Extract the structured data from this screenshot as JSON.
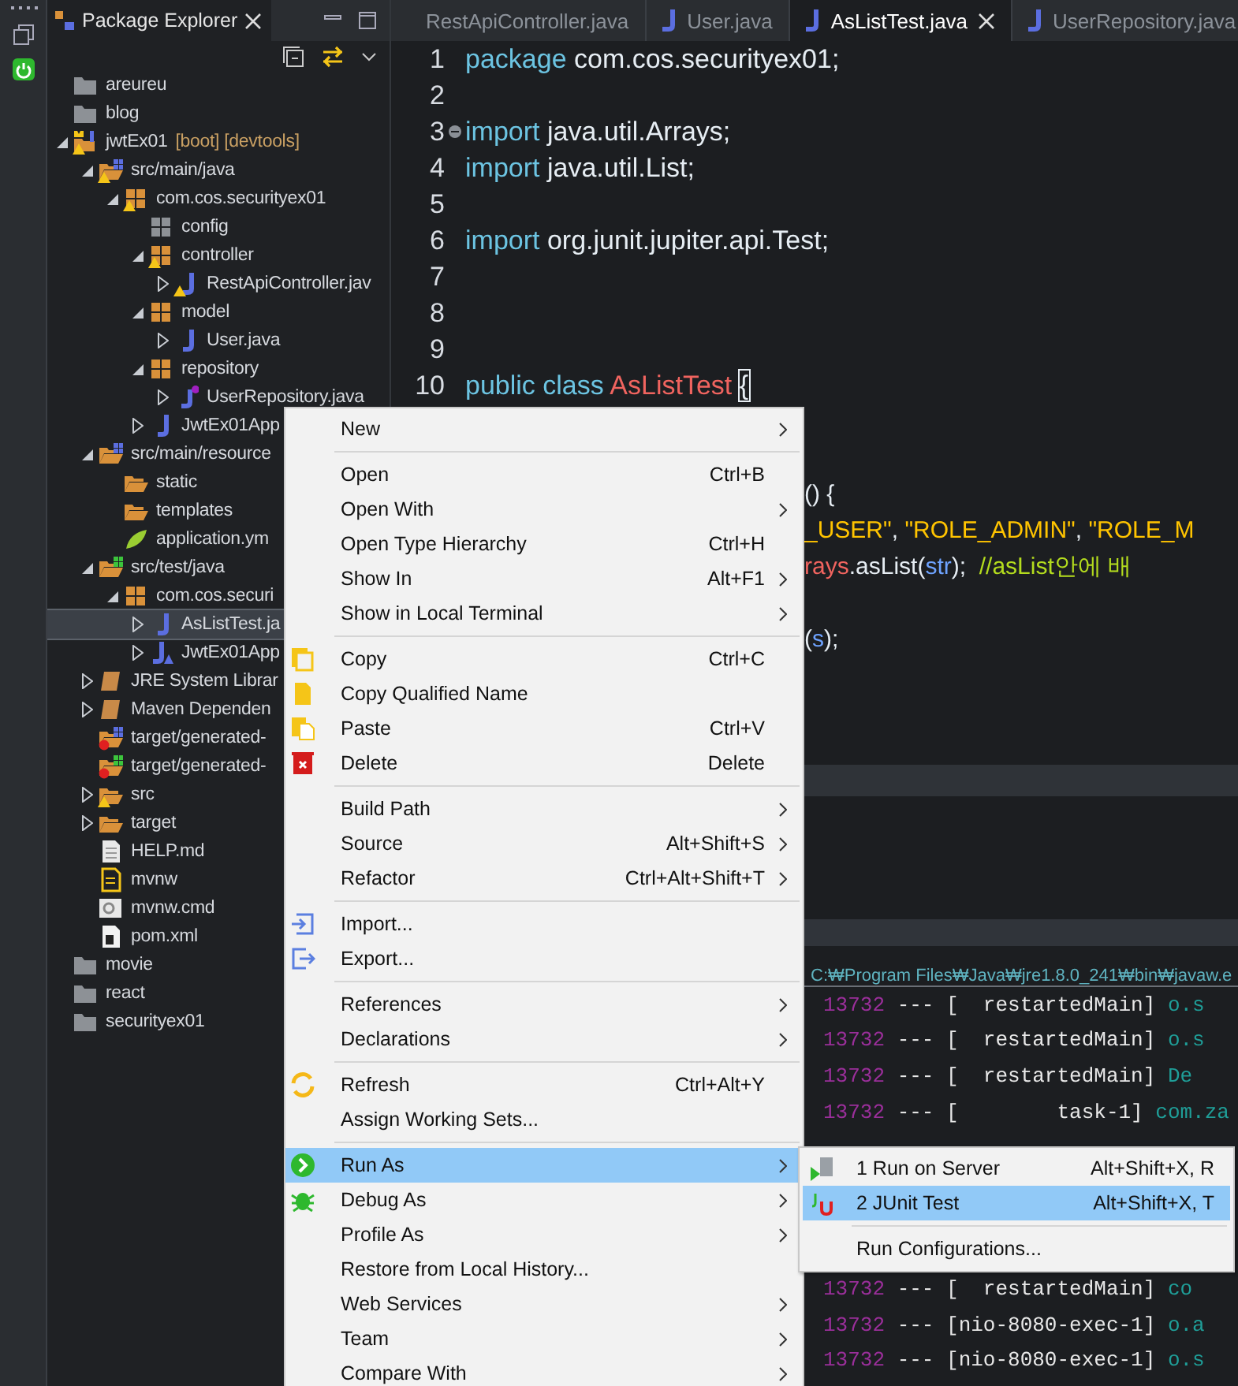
{
  "explorer": {
    "title": "Package Explorer",
    "tree": [
      {
        "label": "areureu",
        "kind": "project-folder",
        "warning": false,
        "selected": false
      },
      {
        "label": "blog",
        "kind": "project-folder",
        "warning": false,
        "selected": false
      },
      {
        "label": "jwtEx01",
        "decoration": "[boot] [devtools]",
        "kind": "java-project",
        "warning": true,
        "selected": false,
        "expanded": true,
        "children": [
          {
            "label": "src/main/java",
            "kind": "source-folder",
            "warning": true,
            "selected": false,
            "expanded": true,
            "children": [
              {
                "label": "com.cos.securityex01",
                "kind": "package",
                "warning": true,
                "selected": false,
                "expanded": true,
                "children": [
                  {
                    "label": "config",
                    "kind": "empty-package",
                    "warning": false,
                    "selected": false
                  },
                  {
                    "label": "controller",
                    "kind": "package",
                    "warning": true,
                    "selected": false,
                    "expanded": true,
                    "children": [
                      {
                        "label": "RestApiController.jav",
                        "kind": "java-file",
                        "warning": true,
                        "selected": false,
                        "expanded": false
                      }
                    ]
                  },
                  {
                    "label": "model",
                    "kind": "package",
                    "warning": false,
                    "selected": false,
                    "expanded": true,
                    "children": [
                      {
                        "label": "User.java",
                        "kind": "java-file",
                        "warning": false,
                        "selected": false,
                        "expanded": false
                      }
                    ]
                  },
                  {
                    "label": "repository",
                    "kind": "package",
                    "warning": false,
                    "selected": false,
                    "expanded": true,
                    "children": [
                      {
                        "label": "UserRepository.java",
                        "kind": "java-interface",
                        "warning": false,
                        "selected": false,
                        "expanded": false
                      }
                    ]
                  },
                  {
                    "label": "JwtEx01App",
                    "kind": "java-file",
                    "warning": false,
                    "selected": false,
                    "expanded": false
                  }
                ]
              }
            ]
          },
          {
            "label": "src/main/resource",
            "kind": "source-folder",
            "warning": false,
            "selected": false,
            "expanded": true,
            "children": [
              {
                "label": "static",
                "kind": "open-folder",
                "warning": false,
                "selected": false
              },
              {
                "label": "templates",
                "kind": "open-folder",
                "warning": false,
                "selected": false
              },
              {
                "label": "application.ym",
                "kind": "yaml-file",
                "warning": false,
                "selected": false
              }
            ]
          },
          {
            "label": "src/test/java",
            "kind": "test-source-folder",
            "warning": false,
            "selected": false,
            "expanded": true,
            "children": [
              {
                "label": "com.cos.securi",
                "kind": "package",
                "warning": false,
                "selected": false,
                "expanded": true,
                "children": [
                  {
                    "label": "AsListTest.ja",
                    "kind": "java-file",
                    "warning": false,
                    "selected": true,
                    "expanded": false
                  },
                  {
                    "label": "JwtEx01App",
                    "kind": "java-test",
                    "warning": false,
                    "selected": false,
                    "expanded": false
                  }
                ]
              }
            ]
          },
          {
            "label": "JRE System Librar",
            "kind": "library",
            "warning": false,
            "selected": false,
            "expanded": false
          },
          {
            "label": "Maven Dependen",
            "kind": "library",
            "warning": false,
            "selected": false,
            "expanded": false
          },
          {
            "label": "target/generated-",
            "kind": "excluded-source-folder",
            "warning": false,
            "selected": false
          },
          {
            "label": "target/generated-",
            "kind": "excluded-test-folder",
            "warning": false,
            "selected": false
          },
          {
            "label": "src",
            "kind": "open-folder",
            "warning": true,
            "selected": false,
            "expanded": false
          },
          {
            "label": "target",
            "kind": "open-folder",
            "warning": false,
            "selected": false,
            "expanded": false
          },
          {
            "label": "HELP.md",
            "kind": "text-file",
            "warning": false,
            "selected": false
          },
          {
            "label": "mvnw",
            "kind": "script-file",
            "warning": false,
            "selected": false
          },
          {
            "label": "mvnw.cmd",
            "kind": "cmd-file",
            "warning": false,
            "selected": false
          },
          {
            "label": "pom.xml",
            "kind": "pom-file",
            "warning": false,
            "selected": false
          }
        ]
      },
      {
        "label": "movie",
        "kind": "project-folder",
        "warning": false,
        "selected": false
      },
      {
        "label": "react",
        "kind": "project-folder",
        "warning": false,
        "selected": false
      },
      {
        "label": "securityex01",
        "kind": "project-folder",
        "warning": false,
        "selected": false
      }
    ]
  },
  "editor": {
    "tabs": [
      {
        "label": "RestApiController.java",
        "icon": false,
        "selected": false
      },
      {
        "label": "User.java",
        "icon": true,
        "selected": false
      },
      {
        "label": "AsListTest.java",
        "icon": true,
        "selected": true
      },
      {
        "label": "UserRepository.java",
        "icon": true,
        "selected": false
      }
    ],
    "lines": [
      {
        "number": "1",
        "tokens": [
          {
            "kind": "keyword",
            "text": "package"
          },
          {
            "kind": "plain",
            "text": " com.cos.securityex01;"
          }
        ]
      },
      {
        "number": "2"
      },
      {
        "number": "3",
        "fold_marker": true,
        "tokens": [
          {
            "kind": "keyword",
            "text": "import"
          },
          {
            "kind": "plain",
            "text": " java.util.Arrays;"
          }
        ]
      },
      {
        "number": "4",
        "tokens": [
          {
            "kind": "keyword",
            "text": "import"
          },
          {
            "kind": "plain",
            "text": " java.util.List;"
          }
        ]
      },
      {
        "number": "5"
      },
      {
        "number": "6",
        "tokens": [
          {
            "kind": "keyword",
            "text": "import"
          },
          {
            "kind": "plain",
            "text": " org.junit.jupiter.api.Test;"
          }
        ]
      },
      {
        "number": "7"
      },
      {
        "number": "8"
      },
      {
        "number": "9"
      },
      {
        "number": "10",
        "tokens": [
          {
            "kind": "keyword",
            "text": "public class "
          },
          {
            "kind": "type",
            "text": "AsListTest "
          },
          {
            "kind": "bracket",
            "text": "{"
          }
        ]
      }
    ],
    "covered_lines": [
      {
        "tokens": [
          {
            "kind": "plain",
            "text": "() {"
          }
        ]
      },
      {
        "tokens": [
          {
            "kind": "string",
            "text": "_USER\""
          },
          {
            "kind": "plain",
            "text": ", "
          },
          {
            "kind": "string",
            "text": "\"ROLE_ADMIN\""
          },
          {
            "kind": "plain",
            "text": ", "
          },
          {
            "kind": "string",
            "text": "\"ROLE_M"
          }
        ]
      },
      {
        "tokens": [
          {
            "kind": "type",
            "text": "rays"
          },
          {
            "kind": "plain",
            "text": ".asList("
          },
          {
            "kind": "variable",
            "text": "str"
          },
          {
            "kind": "plain",
            "text": ");  "
          },
          {
            "kind": "comment",
            "text": "//asList안에 배"
          }
        ]
      },
      {
        "tokens": [
          {
            "kind": "plain",
            "text": "("
          },
          {
            "kind": "variable",
            "text": "s"
          },
          {
            "kind": "plain",
            "text": ");"
          }
        ]
      }
    ]
  },
  "console": {
    "command": "C:₩Program Files₩Java₩jre1.8.0_241₩bin₩javaw.e",
    "lines_top": [
      {
        "pid": "13732",
        "thread": " --- [  restartedMain] ",
        "logger": "o.s"
      },
      {
        "pid": "13732",
        "thread": " --- [  restartedMain] ",
        "logger": "o.s"
      },
      {
        "pid": "13732",
        "thread": " --- [  restartedMain] ",
        "logger": "De"
      },
      {
        "pid": "13732",
        "thread": " --- [        task-1] ",
        "logger": "com.za"
      }
    ],
    "lines_bottom": [
      {
        "pid": "13732",
        "thread": " --- [  restartedMain] ",
        "logger": "co"
      },
      {
        "pid": "13732",
        "thread": " --- [nio-8080-exec-1] ",
        "logger": "o.a"
      },
      {
        "pid": "13732",
        "thread": " --- [nio-8080-exec-1] ",
        "logger": "o.s"
      }
    ]
  },
  "context_menu": {
    "items": [
      {
        "kind": "plain",
        "label": "New",
        "submenu": true,
        "selected": false
      },
      {
        "kind": "separator"
      },
      {
        "kind": "plain",
        "label": "Open",
        "shortcut": "Ctrl+B",
        "submenu": false,
        "selected": false
      },
      {
        "kind": "plain",
        "label": "Open With",
        "submenu": true,
        "selected": false
      },
      {
        "kind": "plain",
        "label": "Open Type Hierarchy",
        "shortcut": "Ctrl+H",
        "submenu": false,
        "selected": false
      },
      {
        "kind": "plain",
        "label": "Show In",
        "shortcut": "Alt+F1",
        "submenu": true,
        "selected": false
      },
      {
        "kind": "plain",
        "label": "Show in Local Terminal",
        "submenu": true,
        "selected": false
      },
      {
        "kind": "separator"
      },
      {
        "kind": "copy",
        "label": "Copy",
        "shortcut": "Ctrl+C",
        "submenu": false,
        "selected": false
      },
      {
        "kind": "document",
        "label": "Copy Qualified Name",
        "submenu": false,
        "selected": false
      },
      {
        "kind": "paste",
        "label": "Paste",
        "shortcut": "Ctrl+V",
        "submenu": false,
        "selected": false
      },
      {
        "kind": "delete",
        "label": "Delete",
        "shortcut": "Delete",
        "submenu": false,
        "selected": false
      },
      {
        "kind": "separator"
      },
      {
        "kind": "plain",
        "label": "Build Path",
        "submenu": true,
        "selected": false
      },
      {
        "kind": "plain",
        "label": "Source",
        "shortcut": "Alt+Shift+S",
        "submenu": true,
        "selected": false
      },
      {
        "kind": "plain",
        "label": "Refactor",
        "shortcut": "Ctrl+Alt+Shift+T",
        "submenu": true,
        "selected": false
      },
      {
        "kind": "separator"
      },
      {
        "kind": "import",
        "label": "Import...",
        "submenu": false,
        "selected": false
      },
      {
        "kind": "export",
        "label": "Export...",
        "submenu": false,
        "selected": false
      },
      {
        "kind": "separator"
      },
      {
        "kind": "plain",
        "label": "References",
        "submenu": true,
        "selected": false
      },
      {
        "kind": "plain",
        "label": "Declarations",
        "submenu": true,
        "selected": false
      },
      {
        "kind": "separator"
      },
      {
        "kind": "refresh",
        "label": "Refresh",
        "shortcut": "Ctrl+Alt+Y",
        "submenu": false,
        "selected": false
      },
      {
        "kind": "plain",
        "label": "Assign Working Sets...",
        "submenu": false,
        "selected": false
      },
      {
        "kind": "separator"
      },
      {
        "kind": "run",
        "label": "Run As",
        "submenu": true,
        "selected": true
      },
      {
        "kind": "bug",
        "label": "Debug As",
        "submenu": true,
        "selected": false
      },
      {
        "kind": "plain",
        "label": "Profile As",
        "submenu": true,
        "selected": false
      },
      {
        "kind": "plain",
        "label": "Restore from Local History...",
        "submenu": false,
        "selected": false
      },
      {
        "kind": "plain",
        "label": "Web Services",
        "submenu": true,
        "selected": false
      },
      {
        "kind": "plain",
        "label": "Team",
        "submenu": true,
        "selected": false
      },
      {
        "kind": "plain",
        "label": "Compare With",
        "submenu": true,
        "selected": false
      }
    ]
  },
  "run_as_submenu": {
    "items": [
      {
        "kind": "server",
        "label": "1 Run on Server",
        "shortcut": "Alt+Shift+X, R",
        "selected": false
      },
      {
        "kind": "junit",
        "label": "2 JUnit Test",
        "shortcut": "Alt+Shift+X, T",
        "selected": true
      },
      {
        "kind": "separator"
      },
      {
        "kind": "plain",
        "label": "Run Configurations...",
        "selected": false
      }
    ]
  }
}
